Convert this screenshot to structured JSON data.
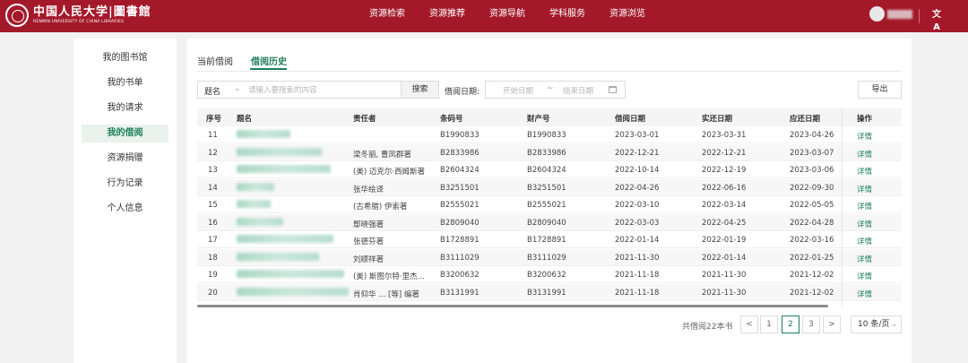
{
  "header": {
    "logo_cn": "中国人民大学|圖書館",
    "logo_en": "RENMIN UNIVERSITY OF CHINA LIBRARIES",
    "nav": [
      "资源检索",
      "资源推荐",
      "资源导航",
      "学科服务",
      "资源浏览"
    ],
    "lang_icon": "文A",
    "brand_color": "#a4192a"
  },
  "sidebar": {
    "items": [
      {
        "label": "我的图书馆",
        "active": false
      },
      {
        "label": "我的书单",
        "active": false
      },
      {
        "label": "我的请求",
        "active": false
      },
      {
        "label": "我的借阅",
        "active": true
      },
      {
        "label": "资源捐赠",
        "active": false
      },
      {
        "label": "行为记录",
        "active": false
      },
      {
        "label": "个人信息",
        "active": false
      }
    ],
    "accent_color": "#1e7f58"
  },
  "tabs": [
    {
      "label": "当前借阅",
      "active": false
    },
    {
      "label": "借阅历史",
      "active": true
    }
  ],
  "search": {
    "field_select": "题名",
    "placeholder": "请输入要搜索的内容",
    "button": "搜索",
    "date_label": "借阅日期:",
    "start_placeholder": "开始日期",
    "separator": "~",
    "end_placeholder": "结束日期",
    "export_button": "导出"
  },
  "table": {
    "columns": [
      "序号",
      "题名",
      "责任者",
      "条码号",
      "财产号",
      "借阅日期",
      "实还日期",
      "应还日期",
      "操作"
    ],
    "rows": [
      {
        "no": "11",
        "title": "",
        "author": "",
        "barcode": "B1990833",
        "property": "B1990833",
        "borrow": "2023-03-01",
        "returned": "2023-03-31",
        "due": "2023-04-26",
        "action": "详情"
      },
      {
        "no": "12",
        "title": "",
        "author": "梁冬丽, 曹凤群著",
        "barcode": "B2833986",
        "property": "B2833986",
        "borrow": "2022-12-21",
        "returned": "2022-12-21",
        "due": "2023-03-07",
        "action": "详情"
      },
      {
        "no": "13",
        "title": "",
        "author": "(美) 迈克尔·西姆斯著",
        "barcode": "B2604324",
        "property": "B2604324",
        "borrow": "2022-10-14",
        "returned": "2022-12-19",
        "due": "2023-03-06",
        "action": "详情"
      },
      {
        "no": "14",
        "title": "",
        "author": "张华绘译",
        "barcode": "B3251501",
        "property": "B3251501",
        "borrow": "2022-04-26",
        "returned": "2022-06-16",
        "due": "2022-09-30",
        "action": "详情"
      },
      {
        "no": "15",
        "title": "",
        "author": "(古希腊) 伊索著",
        "barcode": "B2555021",
        "property": "B2555021",
        "borrow": "2022-03-10",
        "returned": "2022-03-14",
        "due": "2022-05-05",
        "action": "详情"
      },
      {
        "no": "16",
        "title": "",
        "author": "鄢晓强著",
        "barcode": "B2809040",
        "property": "B2809040",
        "borrow": "2022-03-03",
        "returned": "2022-04-25",
        "due": "2022-04-28",
        "action": "详情"
      },
      {
        "no": "17",
        "title": "",
        "author": "张德芬著",
        "barcode": "B1728891",
        "property": "B1728891",
        "borrow": "2022-01-14",
        "returned": "2022-01-19",
        "due": "2022-03-16",
        "action": "详情"
      },
      {
        "no": "18",
        "title": "",
        "author": "刘顺祥著",
        "barcode": "B3111029",
        "property": "B3111029",
        "borrow": "2021-11-30",
        "returned": "2022-01-14",
        "due": "2022-01-25",
        "action": "详情"
      },
      {
        "no": "19",
        "title": "",
        "author": "(美) 斯图尔特·里杰...",
        "barcode": "B3200632",
        "property": "B3200632",
        "borrow": "2021-11-18",
        "returned": "2021-11-30",
        "due": "2021-12-02",
        "action": "详情"
      },
      {
        "no": "20",
        "title": "",
        "author": "肖仰华 ... [等] 编著",
        "barcode": "B3131991",
        "property": "B3131991",
        "borrow": "2021-11-18",
        "returned": "2021-11-30",
        "due": "2021-12-02",
        "action": "详情"
      }
    ]
  },
  "pagination": {
    "total": "共借阅22本书",
    "prev": "<",
    "pages": [
      "1",
      "2",
      "3"
    ],
    "current": "2",
    "next": ">",
    "page_size": "10 条/页"
  }
}
